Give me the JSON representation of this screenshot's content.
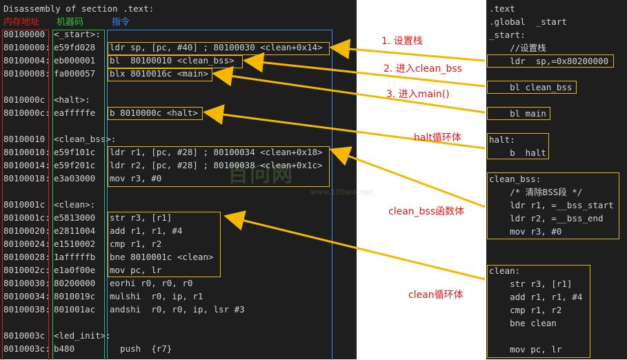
{
  "header": {
    "title": "Disassembly of section .text:",
    "col_addr": "内存地址",
    "col_code": "机器码",
    "col_instr": "指令"
  },
  "disasm": [
    {
      "addr": "80100000",
      "code": "<_start>:",
      "instr": ""
    },
    {
      "addr": "80100000:",
      "code": "e59fd028",
      "instr": "ldr sp, [pc, #40] ; 80100030 <clean+0x14>"
    },
    {
      "addr": "80100004:",
      "code": "eb000001",
      "instr": "bl  80100010 <clean_bss>"
    },
    {
      "addr": "80100008:",
      "code": "fa000057",
      "instr": "blx 8010016c <main>"
    },
    {
      "addr": "",
      "code": "",
      "instr": ""
    },
    {
      "addr": "8010000c",
      "code": "<halt>:",
      "instr": ""
    },
    {
      "addr": "8010000c:",
      "code": "eafffffe",
      "instr": "b 8010000c <halt>"
    },
    {
      "addr": "",
      "code": "",
      "instr": ""
    },
    {
      "addr": "80100010",
      "code": "<clean_bss>:",
      "instr": ""
    },
    {
      "addr": "80100010:",
      "code": "e59f101c",
      "instr": "ldr r1, [pc, #28] ; 80100034 <clean+0x18>"
    },
    {
      "addr": "80100014:",
      "code": "e59f201c",
      "instr": "ldr r2, [pc, #28] ; 80100038 <clean+0x1c>"
    },
    {
      "addr": "80100018:",
      "code": "e3a03000",
      "instr": "mov r3, #0"
    },
    {
      "addr": "",
      "code": "",
      "instr": ""
    },
    {
      "addr": "8010001c",
      "code": "<clean>:",
      "instr": ""
    },
    {
      "addr": "8010001c:",
      "code": "e5813000",
      "instr": "str r3, [r1]"
    },
    {
      "addr": "80100020:",
      "code": "e2811004",
      "instr": "add r1, r1, #4"
    },
    {
      "addr": "80100024:",
      "code": "e1510002",
      "instr": "cmp r1, r2"
    },
    {
      "addr": "80100028:",
      "code": "1afffffb",
      "instr": "bne 8010001c <clean>"
    },
    {
      "addr": "8010002c:",
      "code": "e1a0f00e",
      "instr": "mov pc, lr"
    },
    {
      "addr": "80100030:",
      "code": "80200000",
      "instr": "eorhi r0, r0, r0"
    },
    {
      "addr": "80100034:",
      "code": "8010019c",
      "instr": "mulshi  r0, ip, r1"
    },
    {
      "addr": "80100038:",
      "code": "801001ac",
      "instr": "andshi  r0, r0, ip, lsr #3"
    },
    {
      "addr": "",
      "code": "",
      "instr": ""
    },
    {
      "addr": "8010003c",
      "code": "<led_init>:",
      "instr": ""
    },
    {
      "addr": "8010003c:",
      "code": "b480",
      "instr": "  push  {r7}"
    }
  ],
  "source": [
    ".text",
    ".global  _start",
    "_start:",
    "    //设置栈",
    "    ldr  sp,=0x80200000",
    "",
    "    bl clean_bss",
    "",
    "    bl main",
    "",
    "halt:",
    "    b  halt",
    "",
    "clean_bss:",
    "    /* 清除BSS段 */",
    "    ldr r1, =__bss_start",
    "    ldr r2, =__bss_end",
    "    mov r3, #0",
    "",
    "",
    "clean:",
    "    str r3, [r1]",
    "    add r1, r1, #4",
    "    cmp r1, r2",
    "    bne clean",
    "",
    "    mov pc, lr"
  ],
  "annotations": {
    "a1": "1. 设置栈",
    "a2": "2. 进入clean_bss",
    "a3": "3. 进入main()",
    "a4": "halt循环体",
    "a5": "clean_bss函数体",
    "a6": "clean循环体"
  },
  "watermark": {
    "main": "百问网",
    "url": "www.100ask.net"
  },
  "colors": {
    "addr_box": "#e02020",
    "code_box": "#3cbf3c",
    "instr_box": "#2f8fff",
    "highlight": "#e8b800",
    "arrow": "#f5b800",
    "label": "#e81515"
  }
}
